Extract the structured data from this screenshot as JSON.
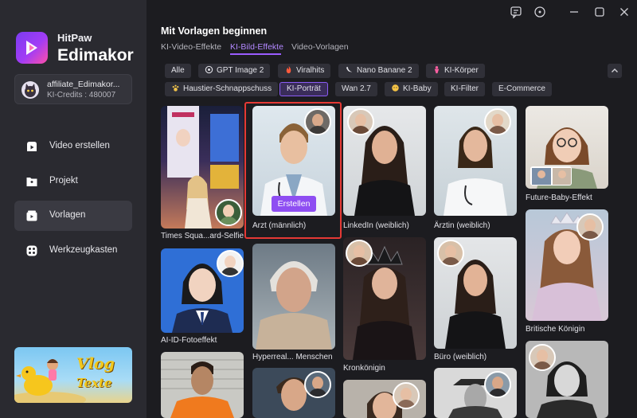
{
  "brand": {
    "top": "HitPaw",
    "main": "Edimakor"
  },
  "account": {
    "name": "affiliate_Edimakor...",
    "credits": "KI-Credits : 480007"
  },
  "nav": [
    {
      "label": "Video erstellen",
      "icon": "video-create-icon"
    },
    {
      "label": "Projekt",
      "icon": "folder-icon"
    },
    {
      "label": "Vorlagen",
      "icon": "template-icon"
    },
    {
      "label": "Werkzeugkasten",
      "icon": "toolbox-icon"
    }
  ],
  "promo": {
    "line1": "Vlog",
    "line2": "Texte"
  },
  "main": {
    "title": "Mit Vorlagen beginnen",
    "tabs": [
      "KI-Video-Effekte",
      "KI-Bild-Effekte",
      "Video-Vorlagen"
    ],
    "active_tab": "KI-Bild-Effekte"
  },
  "filters": {
    "row1": [
      "Alle",
      "GPT Image 2",
      "Viralhits",
      "Nano Banane 2",
      "KI-Körper"
    ],
    "row2": [
      "Haustier-Schnappschuss",
      "KI-Porträt",
      "Wan 2.7",
      "KI-Baby",
      "KI-Filter",
      "E-Commerce"
    ],
    "active": "KI-Porträt"
  },
  "cards": {
    "times_square": "Times Squa...ard-Selfie",
    "arzt": "Arzt (männlich)",
    "linkedin": "LinkedIn (weiblich)",
    "aerztin": "Ärztin (weiblich)",
    "future_baby": "Future-Baby-Effekt",
    "ai_id": "AI-ID-Fotoeffekt",
    "hyperreal": "Hyperreal... Menschen",
    "kronkoenigin": "Kronkönigin",
    "buero": "Büro (weiblich)",
    "britische": "Britische Königin"
  },
  "create_button": "Erstellen",
  "colors": {
    "accent": "#8e4ef2",
    "selection": "#e53935",
    "sidebar": "#2a2a30",
    "background": "#1c1c20"
  }
}
